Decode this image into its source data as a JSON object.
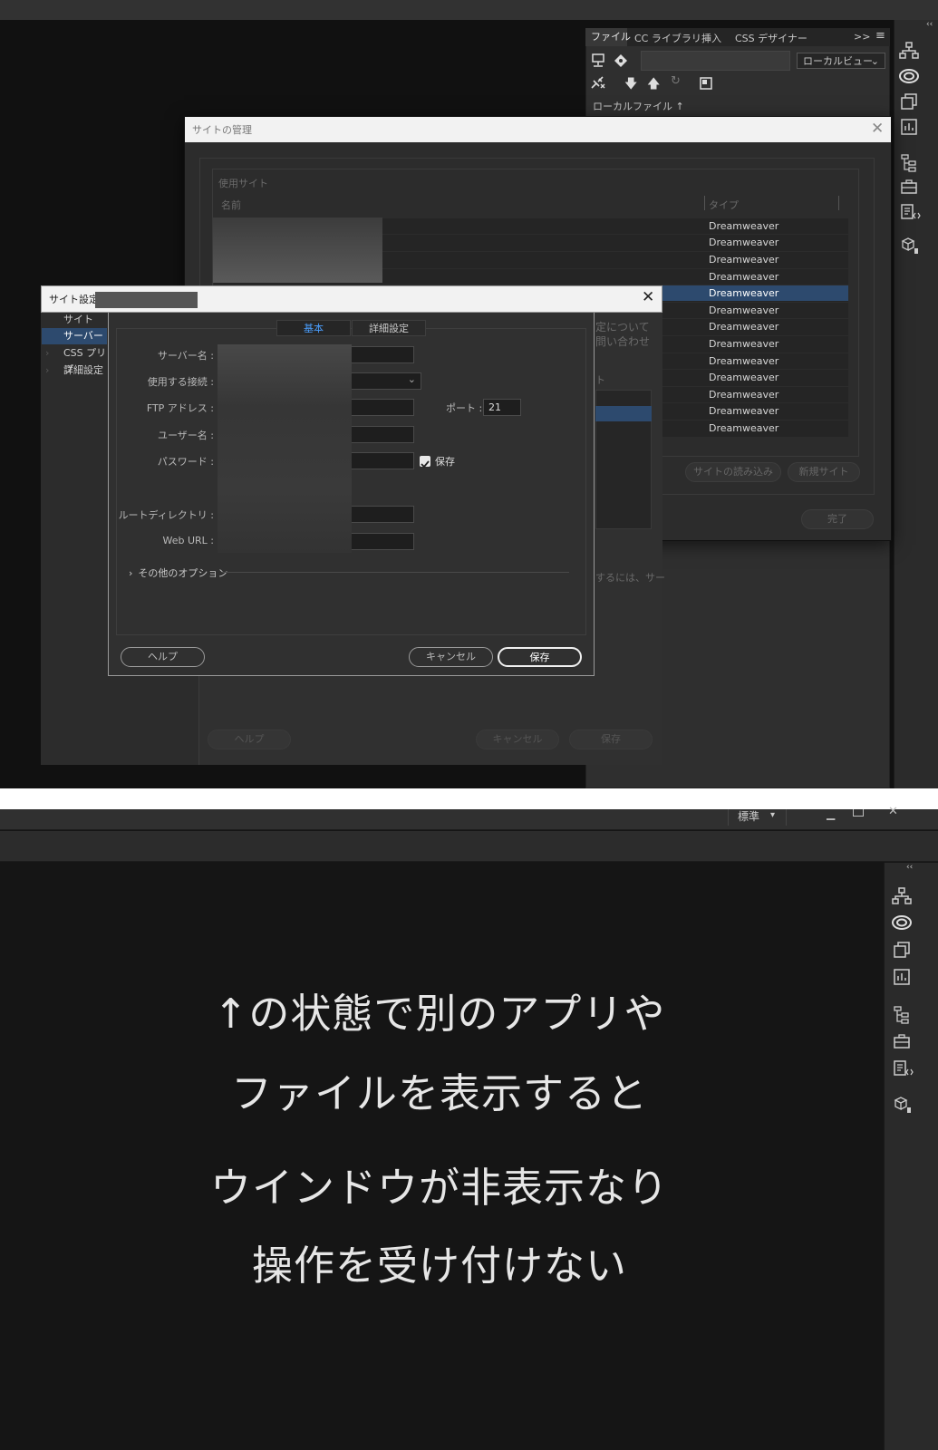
{
  "panel": {
    "tabs": [
      "ファイル",
      "CC ライブラリ",
      "挿入",
      "CSS デザイナー"
    ],
    "expand": ">>",
    "view_select": "ローカルビュー",
    "local_files_label": "ローカルファイル ↑"
  },
  "manage_sites": {
    "title": "サイトの管理",
    "section_label": "使用サイト",
    "col_name": "名前",
    "col_type": "タイプ",
    "rows": [
      "Dreamweaver",
      "Dreamweaver",
      "Dreamweaver",
      "Dreamweaver",
      "Dreamweaver",
      "Dreamweaver",
      "Dreamweaver",
      "Dreamweaver",
      "Dreamweaver",
      "Dreamweaver",
      "Dreamweaver",
      "Dreamweaver",
      "Dreamweaver"
    ],
    "import_button": "サイトの読み込み",
    "new_site_button": "新規サイト",
    "done_button": "完了"
  },
  "back_partial": {
    "line1": "定について",
    "line2": "問い合わせ",
    "col": "ト",
    "note": "するには、サー"
  },
  "site_settings": {
    "title": "サイト設定",
    "sidebar": [
      "サイト",
      "サーバー",
      "CSS プリプ",
      "詳細設定"
    ],
    "tab_basic": "基本",
    "tab_advanced": "詳細設定",
    "labels": {
      "server_name": "サーバー名 :",
      "connection": "使用する接続 :",
      "ftp_address": "FTP アドレス :",
      "username": "ユーザー名 :",
      "password": "パスワード :",
      "root_dir": "ルートディレクトリ :",
      "web_url": "Web URL :",
      "port": "ポート :"
    },
    "port_value": "21",
    "save_password_label": "保存",
    "save_password_checked": true,
    "more_options": "その他のオプション",
    "help_button": "ヘルプ",
    "cancel_button": "キャンセル",
    "save_button": "保存",
    "back_help": "ヘルプ",
    "back_cancel": "キャンセル",
    "back_save": "保存"
  },
  "bottom": {
    "workspace": "標準",
    "lines": [
      "↑の状態で別のアプリや",
      "ファイルを表示すると",
      "ウインドウが非表示なり",
      "操作を受け付けない"
    ]
  },
  "icons": [
    "site-tree-icon",
    "creative-cloud-icon",
    "assets-icon",
    "insert-icon",
    "dom-icon",
    "toolbox-icon",
    "code-snippets-icon",
    "components-icon"
  ]
}
